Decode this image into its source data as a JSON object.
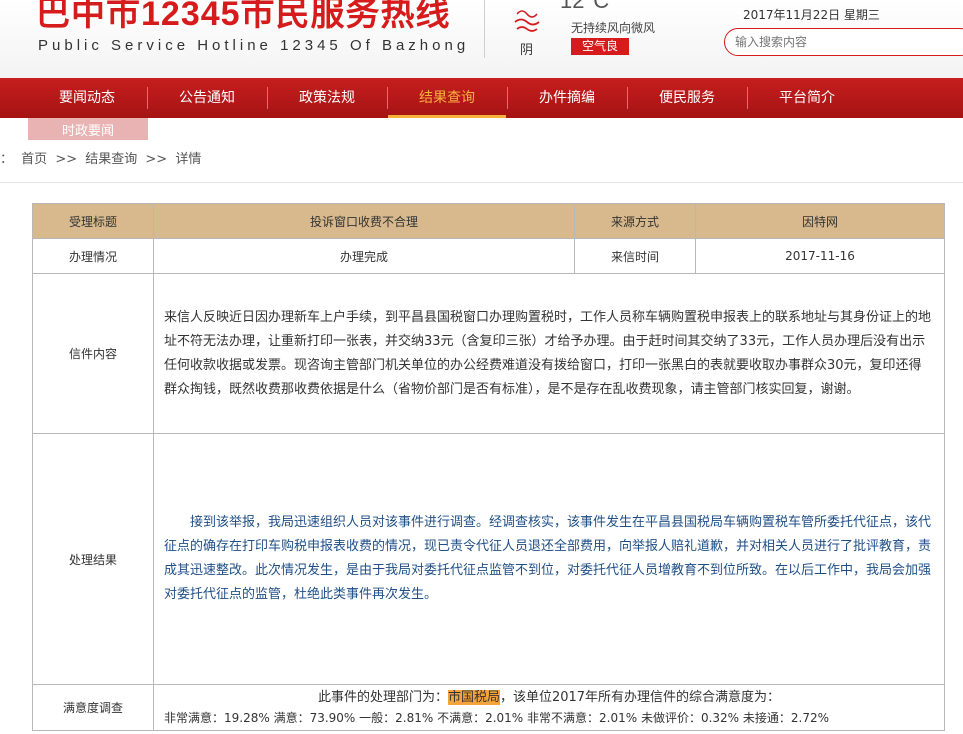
{
  "header": {
    "title": "巴中市12345市民服务热线",
    "subtitle": "Public Service Hotline 12345 Of Bazhong",
    "temperature": "12°C",
    "weather": "阴",
    "wind": "无持续风向微风",
    "air_quality": "空气良",
    "date": "2017年11月22日 星期三",
    "search_placeholder": "输入搜索内容"
  },
  "nav": {
    "items": [
      {
        "label": "要闻动态"
      },
      {
        "label": "公告通知"
      },
      {
        "label": "政策法规"
      },
      {
        "label": "结果查询"
      },
      {
        "label": "办件摘编"
      },
      {
        "label": "便民服务"
      },
      {
        "label": "平台简介"
      }
    ],
    "active_index": 3,
    "sub_item": "时政要闻"
  },
  "breadcrumb": {
    "prefix": "：",
    "items": [
      "首页",
      "结果查询",
      "详情"
    ],
    "separator": ">>"
  },
  "detail": {
    "row1": {
      "label_title": "受理标题",
      "title": "投诉窗口收费不合理",
      "label_source": "来源方式",
      "source": "因特网"
    },
    "row2": {
      "label_status": "办理情况",
      "status": "办理完成",
      "label_date": "来信时间",
      "date": "2017-11-16"
    },
    "content_label": "信件内容",
    "content": "来信人反映近日因办理新车上户手续，到平昌县国税窗口办理购置税时，工作人员称车辆购置税申报表上的联系地址与其身份证上的地址不符无法办理，让重新打印一张表，并交纳33元（含复印三张）才给予办理。由于赶时间其交纳了33元，工作人员办理后没有出示任何收款收据或发票。现咨询主管部门机关单位的办公经费难道没有拨给窗口，打印一张黑白的表就要收取办事群众30元，复印还得群众掏钱，既然收费那收费依据是什么（省物价部门是否有标准），是不是存在乱收费现象，请主管部门核实回复，谢谢。",
    "result_label": "处理结果",
    "result": "接到该举报，我局迅速组织人员对该事件进行调查。经调查核实，该事件发生在平昌县国税局车辆购置税车管所委托代征点，该代征点的确存在打印车购税申报表收费的情况，现已责令代征人员退还全部费用，向举报人赔礼道歉，并对相关人员进行了批评教育，责成其迅速整改。此次情况发生，是由于我局对委托代征点监管不到位，对委托代征人员增教育不到位所致。在以后工作中，我局会加强对委托代征点的监管，杜绝此类事件再次发生。",
    "satisfaction_label": "满意度调查",
    "satisfaction_pre": "此事件的处理部门为：",
    "department": "市国税局",
    "satisfaction_post": "，该单位2017年所有办理信件的综合满意度为：",
    "satisfaction_stats": "非常满意：19.28%   满意：73.90%   一般：2.81%   不满意：2.01%   非常不满意：2.01%   未做评价：0.32%   未接通：2.72%"
  }
}
